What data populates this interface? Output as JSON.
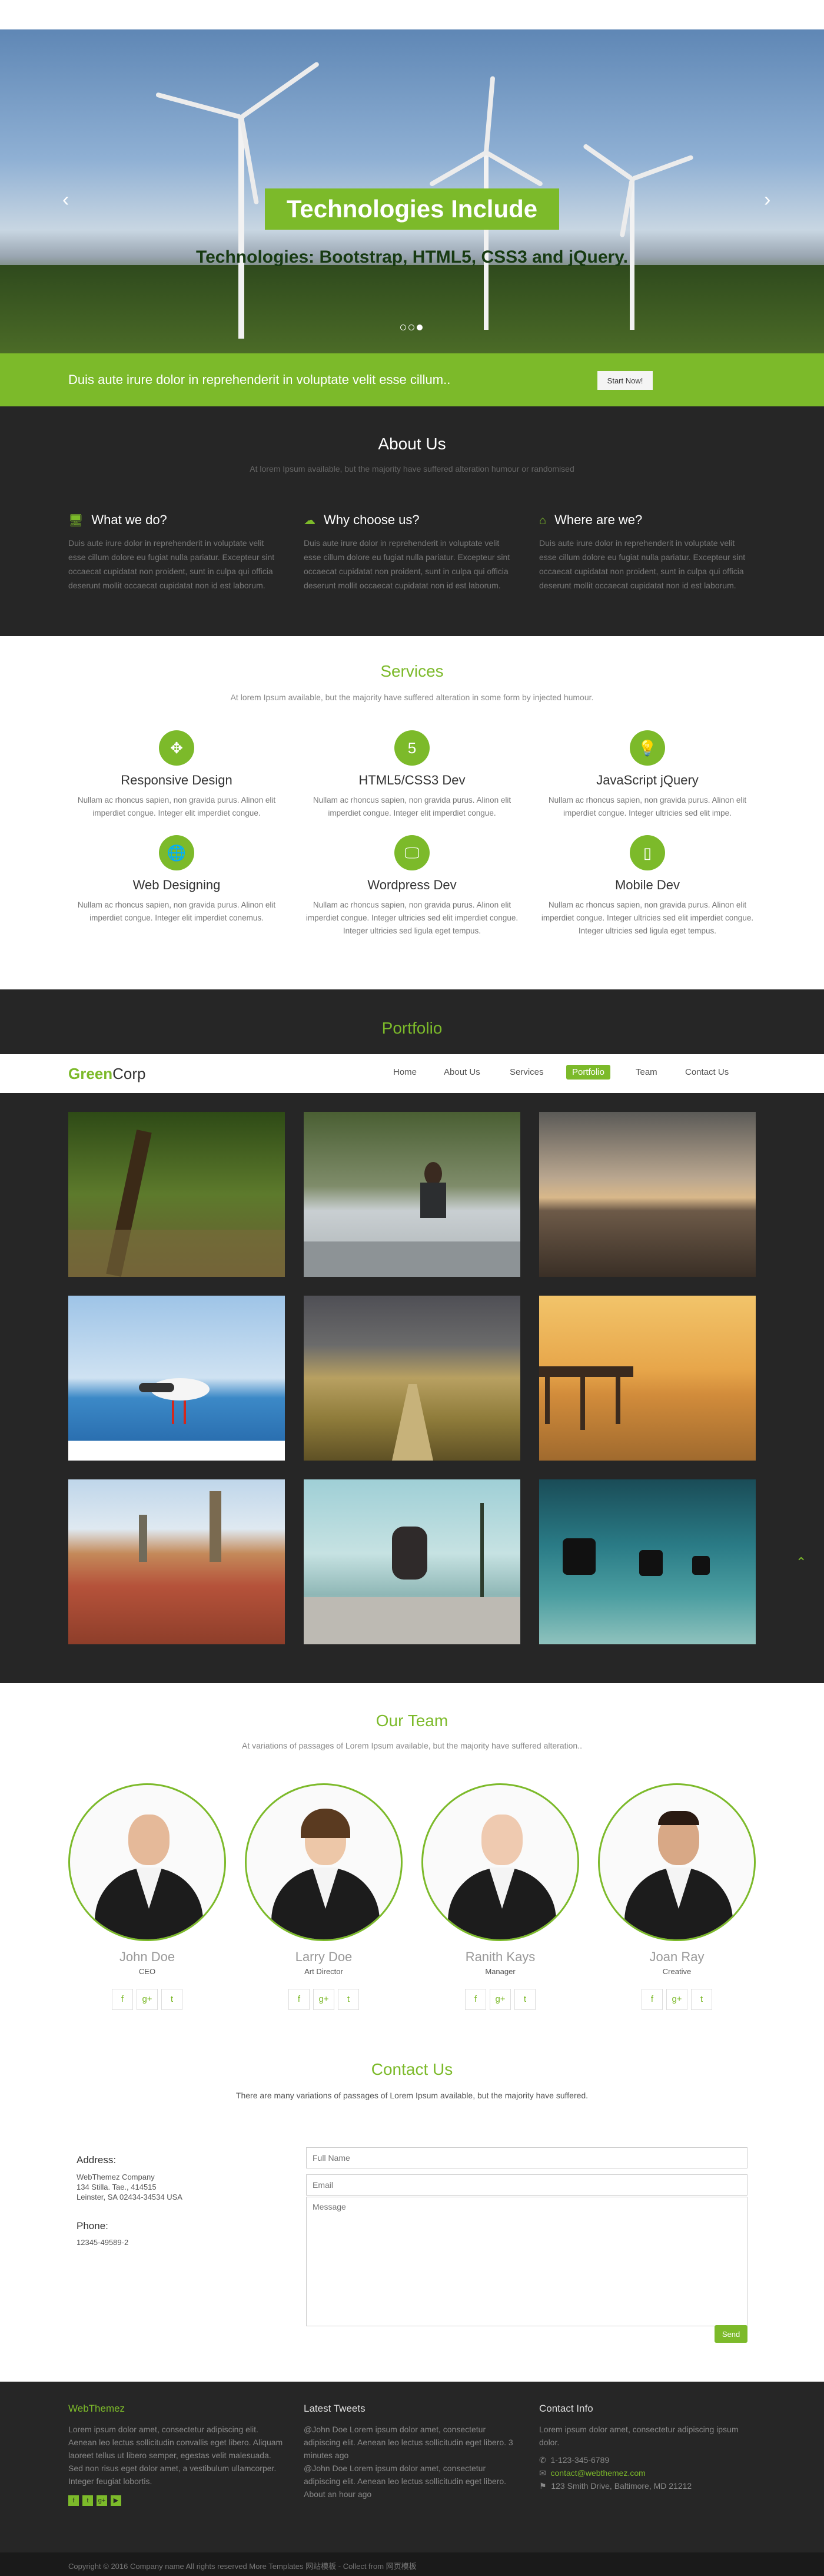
{
  "hero": {
    "title": "Technologies Include",
    "subtitle": "Technologies: Bootstrap, HTML5, CSS3 and jQuery.",
    "prev": "‹",
    "next": "›"
  },
  "cta": {
    "text": "Duis aute irure dolor in reprehenderit in voluptate velit esse cillum..",
    "button": "Start Now!"
  },
  "about": {
    "title": "About Us",
    "subtitle": "At lorem Ipsum available, but the majority have suffered alteration humour or randomised",
    "cols": [
      {
        "icon": "🖥",
        "title": "What we do?",
        "text": "Duis aute irure dolor in reprehenderit in voluptate velit esse cillum dolore eu fugiat nulla pariatur. Excepteur sint occaecat cupidatat non proident, sunt in culpa qui officia deserunt mollit occaecat cupidatat non id est laborum."
      },
      {
        "icon": "☁",
        "title": "Why choose us?",
        "text": "Duis aute irure dolor in reprehenderit in voluptate velit esse cillum dolore eu fugiat nulla pariatur. Excepteur sint occaecat cupidatat non proident, sunt in culpa qui officia deserunt mollit occaecat cupidatat non id est laborum."
      },
      {
        "icon": "⌂",
        "title": "Where are we?",
        "text": "Duis aute irure dolor in reprehenderit in voluptate velit esse cillum dolore eu fugiat nulla pariatur. Excepteur sint occaecat cupidatat non proident, sunt in culpa qui officia deserunt mollit occaecat cupidatat non id est laborum."
      }
    ]
  },
  "services": {
    "title": "Services",
    "subtitle": "At lorem Ipsum available, but the majority have suffered alteration in some form by injected humour.",
    "items": [
      {
        "icon": "✥",
        "title": "Responsive Design",
        "text": "Nullam ac rhoncus sapien, non gravida purus. Alinon elit imperdiet congue. Integer elit imperdiet congue."
      },
      {
        "icon": "5",
        "title": "HTML5/CSS3 Dev",
        "text": "Nullam ac rhoncus sapien, non gravida purus. Alinon elit imperdiet congue. Integer elit imperdiet congue."
      },
      {
        "icon": "💡",
        "title": "JavaScript jQuery",
        "text": "Nullam ac rhoncus sapien, non gravida purus. Alinon elit imperdiet congue. Integer ultricies sed elit impe."
      },
      {
        "icon": "🌐",
        "title": "Web Designing",
        "text": "Nullam ac rhoncus sapien, non gravida purus. Alinon elit imperdiet congue. Integer elit imperdiet conemus."
      },
      {
        "icon": "🖵",
        "title": "Wordpress Dev",
        "text": "Nullam ac rhoncus sapien, non gravida purus. Alinon elit imperdiet congue. Integer ultricies sed elit imperdiet congue. Integer ultricies sed ligula eget tempus."
      },
      {
        "icon": "▯",
        "title": "Mobile Dev",
        "text": "Nullam ac rhoncus sapien, non gravida purus. Alinon elit imperdiet congue. Integer ultricies sed elit imperdiet congue. Integer ultricies sed ligula eget tempus."
      }
    ]
  },
  "portfolio": {
    "title": "Portfolio"
  },
  "nav": {
    "logo_a": "Green",
    "logo_b": "Corp",
    "items": [
      "Home",
      "About Us",
      "Services",
      "Portfolio",
      "Team",
      "Contact Us"
    ]
  },
  "team": {
    "title": "Our Team",
    "subtitle": "At variations of passages of Lorem Ipsum available, but the majority have suffered alteration..",
    "members": [
      {
        "name": "John Doe",
        "role": "CEO"
      },
      {
        "name": "Larry Doe",
        "role": "Art Director"
      },
      {
        "name": "Ranith Kays",
        "role": "Manager"
      },
      {
        "name": "Joan Ray",
        "role": "Creative"
      }
    ],
    "social": [
      "f",
      "g+",
      "t"
    ]
  },
  "contact": {
    "title": "Contact Us",
    "subtitle": "There are many variations of passages of Lorem Ipsum available, but the majority have suffered.",
    "address_label": "Address:",
    "address": [
      "WebThemez Company",
      "134 Stilla. Tae., 414515",
      "Leinster, SA 02434-34534 USA"
    ],
    "phone_label": "Phone:",
    "phone": "12345-49589-2",
    "fullname": "Full Name",
    "email": "Email",
    "message": "Message",
    "send": "Send"
  },
  "footer": {
    "brand": "WebThemez",
    "brand_text": "Lorem ipsum dolor amet, consectetur adipiscing elit. Aenean leo lectus sollicitudin convallis eget libero. Aliquam laoreet tellus ut libero semper, egestas velit malesuada. Sed non risus eget dolor amet, a vestibulum ullamcorper. Integer feugiat lobortis.",
    "tweets_title": "Latest Tweets",
    "tweet1": "@John Doe Lorem ipsum dolor amet, consectetur adipiscing elit. Aenean leo lectus sollicitudin eget libero. 3 minutes ago",
    "tweet2": "@John Doe Lorem ipsum dolor amet, consectetur adipiscing elit. Aenean leo lectus sollicitudin eget libero. About an hour ago",
    "contact_title": "Contact Info",
    "contact_text": "Lorem ipsum dolor amet, consectetur adipiscing ipsum dolor.",
    "phone": "1-123-345-6789",
    "email": "contact@webthemez.com",
    "address": "123 Smith Drive, Baltimore, MD 21212",
    "copyright": "Copyright © 2016 Company name All rights reserved More Templates 网站模板 - Collect from 网页模板"
  },
  "colors": {
    "accent": "#7cba2a",
    "dark": "#262626"
  }
}
